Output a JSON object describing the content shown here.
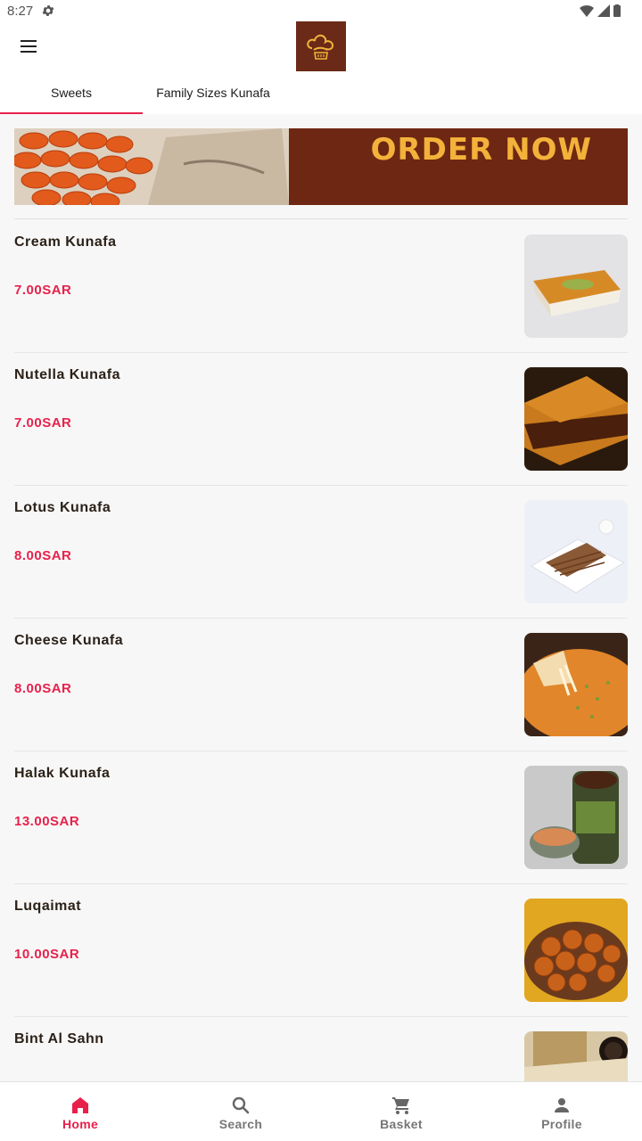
{
  "status_bar": {
    "time": "8:27"
  },
  "tabs": [
    {
      "label": "Sweets",
      "active": true
    },
    {
      "label": "Family Sizes Kunafa",
      "active": false
    }
  ],
  "banner": {
    "text": "ORDER NOW"
  },
  "items": [
    {
      "name": "Cream Kunafa",
      "price": "7.00SAR"
    },
    {
      "name": "Nutella Kunafa",
      "price": "7.00SAR"
    },
    {
      "name": "Lotus Kunafa",
      "price": "8.00SAR"
    },
    {
      "name": "Cheese Kunafa",
      "price": "8.00SAR"
    },
    {
      "name": "Halak Kunafa",
      "price": "13.00SAR"
    },
    {
      "name": "Luqaimat",
      "price": "10.00SAR"
    },
    {
      "name": "Bint Al Sahn",
      "price": ""
    }
  ],
  "bottom_nav": [
    {
      "label": "Home",
      "icon": "home-icon",
      "active": true
    },
    {
      "label": "Search",
      "icon": "search-icon",
      "active": false
    },
    {
      "label": "Basket",
      "icon": "cart-icon",
      "active": false
    },
    {
      "label": "Profile",
      "icon": "person-icon",
      "active": false
    }
  ],
  "colors": {
    "accent": "#e8214b",
    "brand": "#6b2a17",
    "banner_text": "#f3b23a"
  }
}
